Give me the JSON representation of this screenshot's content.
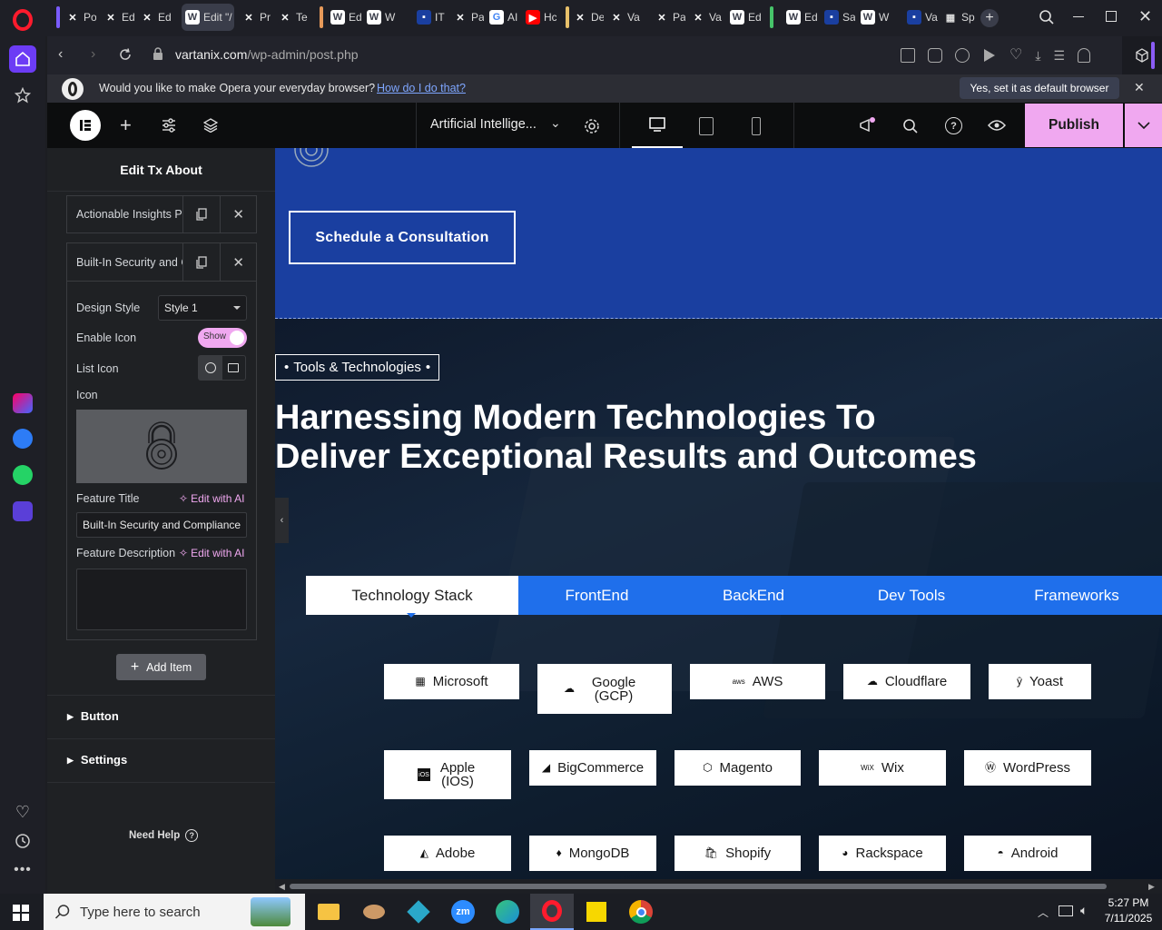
{
  "browser": {
    "tabs": [
      {
        "label": "Po",
        "icon": "x-icon"
      },
      {
        "label": "Ed",
        "icon": "x-icon"
      },
      {
        "label": "Ed",
        "icon": "x-icon"
      },
      {
        "label": "Edit \"/",
        "icon": "wordpress-icon"
      },
      {
        "label": "Pr",
        "icon": "x-icon"
      },
      {
        "label": "Te",
        "icon": "x-icon"
      },
      {
        "label": "Ed",
        "icon": "wordpress-icon"
      },
      {
        "label": "W",
        "icon": "wordpress-icon"
      },
      {
        "label": "IT",
        "icon": "site-icon"
      },
      {
        "label": "Pa",
        "icon": "x-icon"
      },
      {
        "label": "AI",
        "icon": "google-icon"
      },
      {
        "label": "Hc",
        "icon": "youtube-icon"
      },
      {
        "label": "De",
        "icon": "x-icon"
      },
      {
        "label": "Va",
        "icon": "x-icon"
      },
      {
        "label": "Pa",
        "icon": "x-icon"
      },
      {
        "label": "Va",
        "icon": "x-icon"
      },
      {
        "label": "Ed",
        "icon": "wordpress-icon"
      },
      {
        "label": "Ed",
        "icon": "wordpress-icon"
      },
      {
        "label": "Sa",
        "icon": "site-icon"
      },
      {
        "label": "W",
        "icon": "wordpress-icon"
      },
      {
        "label": "Va",
        "icon": "site-icon"
      },
      {
        "label": "Sp",
        "icon": "grid-icon"
      }
    ],
    "url_host": "vartanix.com",
    "url_path": "/wp-admin/post.php",
    "default_prompt": "Would you like to make Opera your everyday browser?",
    "default_link": "How do I do that?",
    "default_button": "Yes, set it as default browser"
  },
  "editor": {
    "page_title": "Artificial Intellige...",
    "publish": "Publish",
    "panel_title": "Edit Tx About",
    "repeater_items": [
      "Actionable Insights Po",
      "Built-In Security and C"
    ],
    "design_style_label": "Design Style",
    "design_style_value": "Style 1",
    "enable_icon_label": "Enable Icon",
    "toggle_text": "Show",
    "list_icon_label": "List Icon",
    "icon_label": "Icon",
    "feature_title_label": "Feature Title",
    "edit_with_ai": "Edit with AI",
    "feature_title_value": "Built-In Security and Compliance",
    "feature_desc_label": "Feature Description",
    "feature_desc_value": "",
    "add_item": "Add Item",
    "section_button": "Button",
    "section_settings": "Settings",
    "need_help": "Need Help"
  },
  "canvas": {
    "cta": "Schedule a Consultation",
    "tag": "Tools & Technologies",
    "heading_line1": "Harnessing Modern Technologies To",
    "heading_line2": "Deliver Exceptional Results and Outcomes",
    "tabs": [
      "Technology Stack",
      "FrontEnd",
      "BackEnd",
      "Dev Tools",
      "Frameworks"
    ],
    "techs": [
      {
        "name": "Microsoft",
        "icon": "windows-icon"
      },
      {
        "name": "Google (GCP)",
        "icon": "cloud-icon"
      },
      {
        "name": "AWS",
        "icon": "aws-icon"
      },
      {
        "name": "Cloudflare",
        "icon": "cloudflare-icon"
      },
      {
        "name": "Yoast",
        "icon": "yoast-icon"
      },
      {
        "name": "Apple (IOS)",
        "icon": "ios-icon"
      },
      {
        "name": "BigCommerce",
        "icon": "bigcommerce-icon"
      },
      {
        "name": "Magento",
        "icon": "magento-icon"
      },
      {
        "name": "Wix",
        "icon": "wix-icon"
      },
      {
        "name": "WordPress",
        "icon": "wordpress-icon"
      },
      {
        "name": "Adobe",
        "icon": "adobe-icon"
      },
      {
        "name": "MongoDB",
        "icon": "mongodb-icon"
      },
      {
        "name": "Shopify",
        "icon": "shopify-icon"
      },
      {
        "name": "Rackspace",
        "icon": "rackspace-icon"
      },
      {
        "name": "Android",
        "icon": "android-icon"
      }
    ]
  },
  "taskbar": {
    "search_placeholder": "Type here to search",
    "time": "5:27 PM",
    "date": "7/11/2025"
  },
  "colors": {
    "brand_blue": "#1a3fa0",
    "tab_blue": "#1f6feb",
    "publish_pink": "#f0a8f0",
    "opera_red": "#ff1b2d"
  }
}
